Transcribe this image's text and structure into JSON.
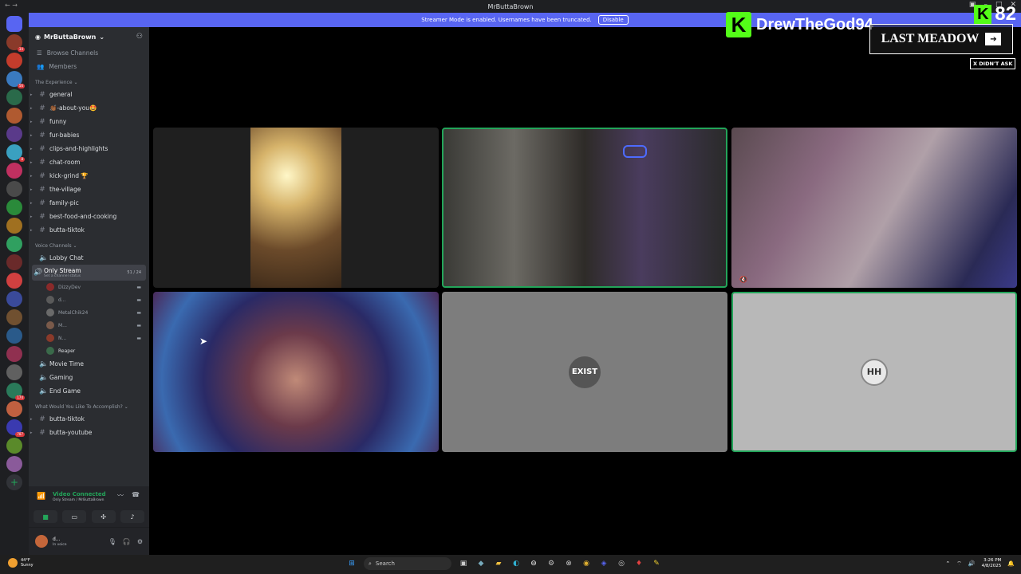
{
  "window": {
    "title": "MrButtaBrown"
  },
  "banner": {
    "text": "Streamer Mode is enabled. Usernames have been truncated.",
    "button": "Disable"
  },
  "guild_badges": [
    "34",
    "",
    "56",
    "",
    "",
    "",
    "8",
    "",
    "",
    "",
    "",
    "",
    "",
    "",
    "",
    "",
    "",
    "",
    "",
    "174",
    "",
    "787",
    "",
    ""
  ],
  "server": {
    "name": "MrButtaBrown"
  },
  "nav": {
    "browse": "Browse Channels",
    "members": "Members"
  },
  "categories": {
    "experience": "The Experience",
    "voice": "Voice Channels",
    "accomplish": "What Would You Like To Accomplish?"
  },
  "text_channels": [
    "general",
    "👏🏾-about-you🤩",
    "funny",
    "fur-babies",
    "clips-and-highlights",
    "chat-room",
    "kick-grind 🏆",
    "the-village",
    "family-pic",
    "best-food-and-cooking",
    "butta-tiktok"
  ],
  "voice_channels": {
    "lobby": "Lobby Chat",
    "only_stream": "Only Stream",
    "only_stream_count": "51 / 24",
    "only_stream_status": "Set a channel status",
    "users": [
      "DizzyDev",
      "d...",
      "MetalChik24",
      "M...",
      "N...",
      "Reaper"
    ],
    "movie": "Movie Time",
    "gaming": "Gaming",
    "endgame": "End Game"
  },
  "bottom_channels": [
    "butta-tiktok",
    "butta-youtube"
  ],
  "voice_panel": {
    "title": "Video Connected",
    "subtitle": "Only Stream / MrButtaBrown"
  },
  "user": {
    "name": "d...",
    "status": "In voice"
  },
  "tiles": {
    "exist_label": "EXIST",
    "hh_label": "HH"
  },
  "overlay": {
    "streamer": "DrewTheGod94",
    "viewers": "82",
    "meadow": "LAST MEADOW",
    "didnt_ask": "X DIDN'T ASK"
  },
  "taskbar": {
    "temp": "44°F",
    "weather": "Sunny",
    "search": "Search",
    "time": "3:26 PM",
    "date": "4/8/2025"
  },
  "colors": {
    "accent": "#5865f2",
    "speaking": "#23a55a",
    "kick": "#53fc18"
  }
}
